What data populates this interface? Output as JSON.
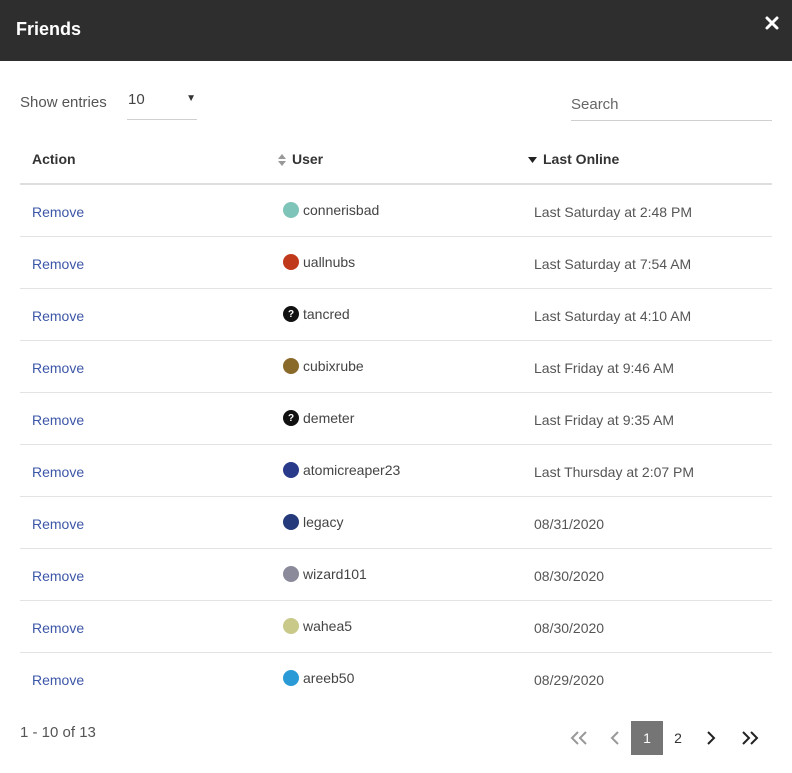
{
  "dialog": {
    "title": "Friends",
    "close_icon": "close-icon"
  },
  "controls": {
    "show_entries_label": "Show entries",
    "entries_value": "10",
    "search_placeholder": "Search"
  },
  "table": {
    "headers": {
      "action": "Action",
      "user": "User",
      "last_online": "Last Online"
    },
    "sort": {
      "column": "last_online",
      "direction": "descending"
    },
    "rows": [
      {
        "action": "Remove",
        "user": "connerisbad",
        "last_online": "Last Saturday at 2:48 PM",
        "avatar_color": "#7fc4b8"
      },
      {
        "action": "Remove",
        "user": "uallnubs",
        "last_online": "Last Saturday at 7:54 AM",
        "avatar_color": "#c0391b"
      },
      {
        "action": "Remove",
        "user": "tancred",
        "last_online": "Last Saturday at 4:10 AM",
        "avatar_color": "#111111"
      },
      {
        "action": "Remove",
        "user": "cubixrube",
        "last_online": "Last Friday at 9:46 AM",
        "avatar_color": "#8a6a2a"
      },
      {
        "action": "Remove",
        "user": "demeter",
        "last_online": "Last Friday at 9:35 AM",
        "avatar_color": "#111111"
      },
      {
        "action": "Remove",
        "user": "atomicreaper23",
        "last_online": "Last Thursday at 2:07 PM",
        "avatar_color": "#2a3a8a"
      },
      {
        "action": "Remove",
        "user": "legacy",
        "last_online": "08/31/2020",
        "avatar_color": "#243a7a"
      },
      {
        "action": "Remove",
        "user": "wizard101",
        "last_online": "08/30/2020",
        "avatar_color": "#8a8a9a"
      },
      {
        "action": "Remove",
        "user": "wahea5",
        "last_online": "08/30/2020",
        "avatar_color": "#c9c98a"
      },
      {
        "action": "Remove",
        "user": "areeb50",
        "last_online": "08/29/2020",
        "avatar_color": "#2a9ad6"
      }
    ]
  },
  "footer": {
    "info": "1 - 10 of 13",
    "pages": [
      "1",
      "2"
    ],
    "current_page": "1"
  },
  "colors": {
    "header_bg": "#2e2e2e",
    "link": "#3d57a8",
    "current_page_bg": "#757575"
  }
}
